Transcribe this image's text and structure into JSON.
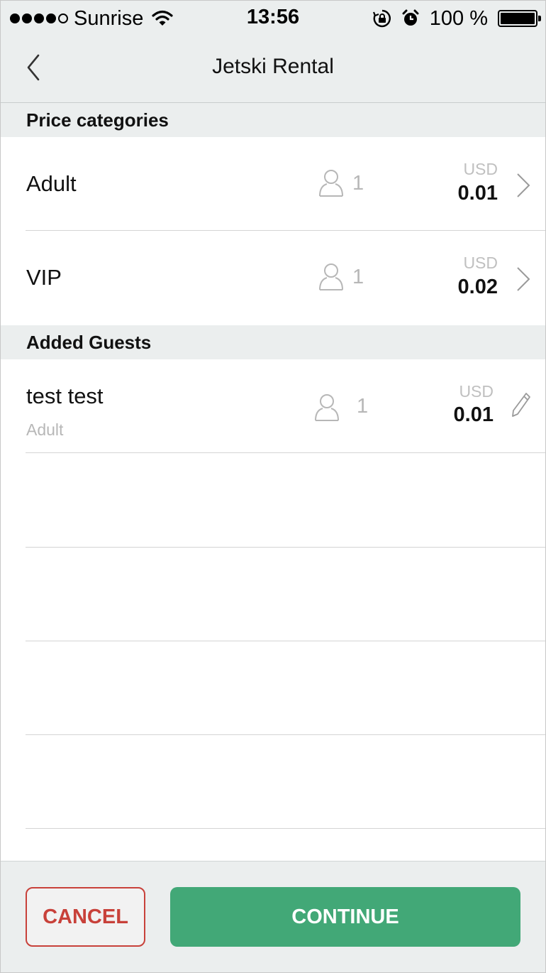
{
  "status_bar": {
    "carrier": "Sunrise",
    "time": "13:56",
    "battery": "100 %"
  },
  "nav": {
    "title": "Jetski Rental"
  },
  "sections": {
    "price_categories": "Price categories",
    "added_guests": "Added Guests"
  },
  "price_categories": [
    {
      "name": "Adult",
      "count": "1",
      "currency": "USD",
      "amount": "0.01"
    },
    {
      "name": "VIP",
      "count": "1",
      "currency": "USD",
      "amount": "0.02"
    }
  ],
  "guests": [
    {
      "name": "test test",
      "category": "Adult",
      "count": "1",
      "currency": "USD",
      "amount": "0.01"
    }
  ],
  "footer": {
    "cancel_label": "CANCEL",
    "continue_label": "CONTINUE"
  },
  "colors": {
    "cancel": "#c8413a",
    "continue": "#42a877",
    "header_bg": "#ebeeee"
  }
}
